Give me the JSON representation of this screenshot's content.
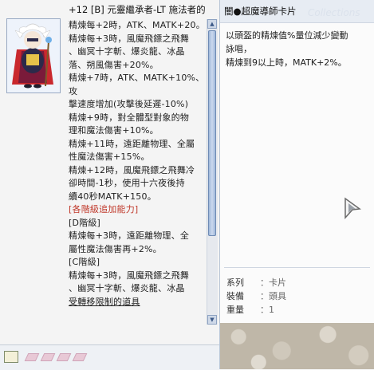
{
  "item": {
    "title": "+12 [B] 元靈繼承者-LT 施法者的",
    "lines": [
      {
        "text": "精煉每+2時，ATK、MATK+20。",
        "style": "normal"
      },
      {
        "text": "精煉每+3時，風魔飛鏢之飛舞\n、幽冥十字斬、爆炎龍、冰晶\n落、朔風傷害+20%。",
        "style": "normal"
      },
      {
        "text": "精煉+7時，ATK、MATK+10%、攻\n擊速度增加(攻擊後延遲-10%)",
        "style": "normal"
      },
      {
        "text": "精煉+9時，對全體型對象的物\n理和魔法傷害+10%。",
        "style": "normal"
      },
      {
        "text": "精煉+11時，遠距離物理、全屬\n性魔法傷害+15%。",
        "style": "normal"
      },
      {
        "text": "精煉+12時，風魔飛鏢之飛舞冷\n卻時間-1秒，使用十六夜後持\n續40秒MATK+150。",
        "style": "normal"
      },
      {
        "text": "[各階級追加能力]",
        "style": "red"
      },
      {
        "text": "[D階級]",
        "style": "normal"
      },
      {
        "text": "精煉每+3時，遠距離物理、全\n屬性魔法傷害再+2%。",
        "style": "normal"
      },
      {
        "text": "[C階級]",
        "style": "normal"
      },
      {
        "text": "精煉每+3時，風魔飛鏢之飛舞\n、幽冥十字斬、爆炎龍、冰晶",
        "style": "normal"
      },
      {
        "text": "受轉移限制的道具",
        "style": "underline"
      }
    ]
  },
  "card": {
    "title": "闇●超魔導師卡片",
    "watermark": "Collections",
    "description": "以頭盔的精煉值%量位減少變動\n詠唱，\n精煉到9以上時，MATK+2%。",
    "info": [
      {
        "key": "系列",
        "value": "卡片"
      },
      {
        "key": "裝備",
        "value": "頭具"
      },
      {
        "key": "重量",
        "value": "1"
      }
    ]
  },
  "icons": {
    "scroll_up": "scroll-up-icon",
    "scroll_down": "scroll-down-icon",
    "book": "book-icon",
    "card_slot": "card-slot-icon",
    "cursor": "mouse-cursor-icon"
  },
  "colors": {
    "accent_red": "#c0392b",
    "scroll_blue": "#9fb7d9"
  }
}
